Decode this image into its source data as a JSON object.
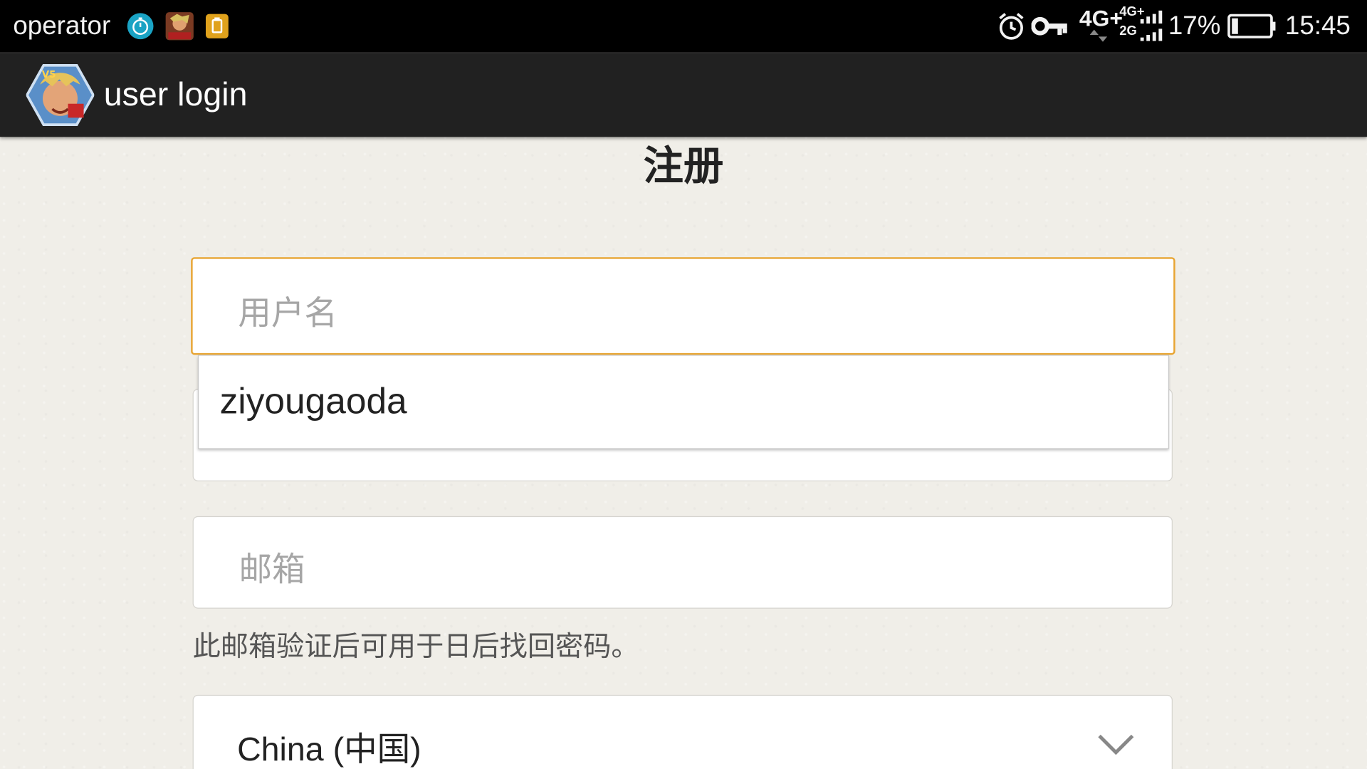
{
  "status_bar": {
    "carrier": "operator",
    "network_primary": "4G+",
    "network_secondary_top": "4G+",
    "network_secondary_bottom": "2G",
    "battery_percent": "17%",
    "battery_level": 0.17,
    "time": "15:45",
    "icons": [
      "timer-icon",
      "game-notification-icon",
      "clipboard-notification-icon",
      "alarm-icon",
      "key-icon",
      "signal-icon",
      "battery-icon"
    ]
  },
  "action_bar": {
    "title": "user login",
    "icon": "app-avatar-icon"
  },
  "form": {
    "title": "注册",
    "username_placeholder": "用户名",
    "email_placeholder": "邮箱",
    "email_helper": "此邮箱验证后可用于日后找回密码。",
    "country_value": "China (中国)",
    "country_icon": "chevron-down-icon"
  },
  "autocomplete": {
    "suggestions": [
      "ziyougaoda"
    ]
  },
  "colors": {
    "status_bar_bg": "#000000",
    "action_bar_bg": "#212121",
    "focus_border": "#e8a533",
    "page_bg": "#f0eee8"
  }
}
